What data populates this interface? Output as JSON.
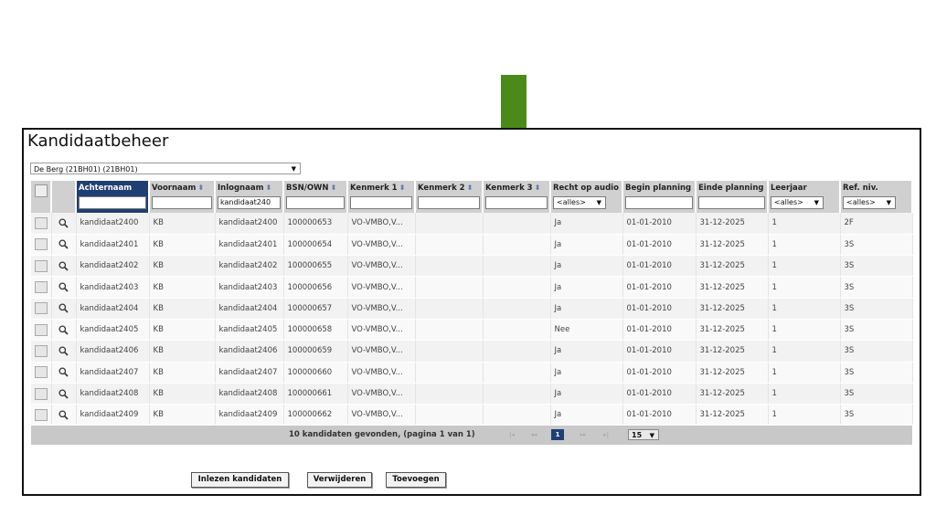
{
  "page": {
    "title": "Kandidaatbeheer",
    "school_select": "De Berg (21BH01) (21BH01)"
  },
  "colors": {
    "arrow": "#4a8a1a",
    "header_active": "#1f3f74",
    "header_bg": "#d0d0d0"
  },
  "columns": [
    {
      "label": "",
      "filter": "checkbox"
    },
    {
      "label": "",
      "filter": "none"
    },
    {
      "label": "Achternaam",
      "filter": "text",
      "value": ""
    },
    {
      "label": "Voornaam",
      "filter": "text",
      "value": ""
    },
    {
      "label": "Inlognaam",
      "filter": "text",
      "value": "kandidaat240"
    },
    {
      "label": "BSN/OWN",
      "filter": "text",
      "value": ""
    },
    {
      "label": "Kenmerk 1",
      "filter": "text",
      "value": ""
    },
    {
      "label": "Kenmerk 2",
      "filter": "text",
      "value": ""
    },
    {
      "label": "Kenmerk 3",
      "filter": "text",
      "value": ""
    },
    {
      "label": "Recht op audio",
      "filter": "select",
      "value": "<alles>"
    },
    {
      "label": "Begin planning",
      "filter": "text",
      "value": ""
    },
    {
      "label": "Einde planning",
      "filter": "text",
      "value": ""
    },
    {
      "label": "Leerjaar",
      "filter": "select",
      "value": "<alles>"
    },
    {
      "label": "Ref. niv.",
      "filter": "select",
      "value": "<alles>"
    }
  ],
  "rows": [
    {
      "achternaam": "kandidaat2400",
      "voornaam": "KB",
      "inlognaam": "kandidaat2400",
      "bsn": "100000653",
      "kenmerk1": "VO-VMBO,V...",
      "kenmerk2": "",
      "kenmerk3": "",
      "audio": "Ja",
      "begin": "01-01-2010",
      "einde": "31-12-2025",
      "leerjaar": "1",
      "refniv": "2F"
    },
    {
      "achternaam": "kandidaat2401",
      "voornaam": "KB",
      "inlognaam": "kandidaat2401",
      "bsn": "100000654",
      "kenmerk1": "VO-VMBO,V...",
      "kenmerk2": "",
      "kenmerk3": "",
      "audio": "Ja",
      "begin": "01-01-2010",
      "einde": "31-12-2025",
      "leerjaar": "1",
      "refniv": "3S"
    },
    {
      "achternaam": "kandidaat2402",
      "voornaam": "KB",
      "inlognaam": "kandidaat2402",
      "bsn": "100000655",
      "kenmerk1": "VO-VMBO,V...",
      "kenmerk2": "",
      "kenmerk3": "",
      "audio": "Ja",
      "begin": "01-01-2010",
      "einde": "31-12-2025",
      "leerjaar": "1",
      "refniv": "3S"
    },
    {
      "achternaam": "kandidaat2403",
      "voornaam": "KB",
      "inlognaam": "kandidaat2403",
      "bsn": "100000656",
      "kenmerk1": "VO-VMBO,V...",
      "kenmerk2": "",
      "kenmerk3": "",
      "audio": "Ja",
      "begin": "01-01-2010",
      "einde": "31-12-2025",
      "leerjaar": "1",
      "refniv": "3S"
    },
    {
      "achternaam": "kandidaat2404",
      "voornaam": "KB",
      "inlognaam": "kandidaat2404",
      "bsn": "100000657",
      "kenmerk1": "VO-VMBO,V...",
      "kenmerk2": "",
      "kenmerk3": "",
      "audio": "Ja",
      "begin": "01-01-2010",
      "einde": "31-12-2025",
      "leerjaar": "1",
      "refniv": "3S"
    },
    {
      "achternaam": "kandidaat2405",
      "voornaam": "KB",
      "inlognaam": "kandidaat2405",
      "bsn": "100000658",
      "kenmerk1": "VO-VMBO,V...",
      "kenmerk2": "",
      "kenmerk3": "",
      "audio": "Nee",
      "begin": "01-01-2010",
      "einde": "31-12-2025",
      "leerjaar": "1",
      "refniv": "3S"
    },
    {
      "achternaam": "kandidaat2406",
      "voornaam": "KB",
      "inlognaam": "kandidaat2406",
      "bsn": "100000659",
      "kenmerk1": "VO-VMBO,V...",
      "kenmerk2": "",
      "kenmerk3": "",
      "audio": "Ja",
      "begin": "01-01-2010",
      "einde": "31-12-2025",
      "leerjaar": "1",
      "refniv": "3S"
    },
    {
      "achternaam": "kandidaat2407",
      "voornaam": "KB",
      "inlognaam": "kandidaat2407",
      "bsn": "100000660",
      "kenmerk1": "VO-VMBO,V...",
      "kenmerk2": "",
      "kenmerk3": "",
      "audio": "Ja",
      "begin": "01-01-2010",
      "einde": "31-12-2025",
      "leerjaar": "1",
      "refniv": "3S"
    },
    {
      "achternaam": "kandidaat2408",
      "voornaam": "KB",
      "inlognaam": "kandidaat2408",
      "bsn": "100000661",
      "kenmerk1": "VO-VMBO,V...",
      "kenmerk2": "",
      "kenmerk3": "",
      "audio": "Ja",
      "begin": "01-01-2010",
      "einde": "31-12-2025",
      "leerjaar": "1",
      "refniv": "3S"
    },
    {
      "achternaam": "kandidaat2409",
      "voornaam": "KB",
      "inlognaam": "kandidaat2409",
      "bsn": "100000662",
      "kenmerk1": "VO-VMBO,V...",
      "kenmerk2": "",
      "kenmerk3": "",
      "audio": "Ja",
      "begin": "01-01-2010",
      "einde": "31-12-2025",
      "leerjaar": "1",
      "refniv": "3S"
    }
  ],
  "pager": {
    "count_text": "10 kandidaten gevonden, (pagina 1 van 1)",
    "first": "|◂",
    "prev": "◂◂",
    "current_page": "1",
    "next": "▸▸",
    "last": "▸|",
    "page_size": "15"
  },
  "buttons": {
    "import": "Inlezen kandidaten",
    "delete": "Verwijderen",
    "add": "Toevoegen"
  }
}
